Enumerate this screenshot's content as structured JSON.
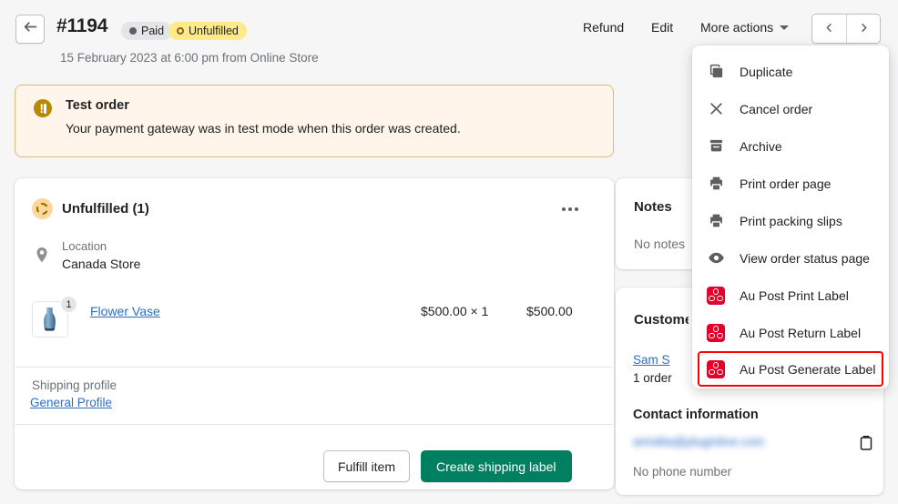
{
  "header": {
    "back_icon": "arrow-left-icon",
    "order_number": "#1194",
    "badges": [
      {
        "label": "Paid",
        "style": "grey",
        "icon": "filled-dot-icon"
      },
      {
        "label": "Unfulfilled",
        "style": "yellow",
        "icon": "hollow-ring-icon"
      }
    ],
    "order_meta": "15 February 2023 at 6:00 pm from Online Store",
    "actions": {
      "refund": "Refund",
      "edit": "Edit",
      "more_actions": "More actions"
    },
    "pager": {
      "prev_icon": "chevron-left-icon",
      "next_icon": "chevron-right-icon"
    }
  },
  "banner": {
    "icon": "alert-circle-icon",
    "title": "Test order",
    "body": "Your payment gateway was in test mode when this order was created.",
    "accent_color": "#b98900",
    "background_color": "#fff5ea"
  },
  "fulfillment": {
    "status_icon": "dashed-circle-icon",
    "title": "Unfulfilled (1)",
    "more_icon": "ellipsis-horizontal-icon",
    "location_icon": "map-pin-icon",
    "location_label": "Location",
    "location_value": "Canada Store",
    "line_item": {
      "image": "flower-vase-thumbnail",
      "quantity_badge": "1",
      "name": "Flower Vase",
      "unit_price": "$500.00 × 1",
      "total_price": "$500.00"
    },
    "shipping_profile_label": "Shipping profile",
    "shipping_profile_value": "General Profile",
    "buttons": {
      "secondary": "Fulfill item",
      "primary": "Create shipping label",
      "primary_color": "#008060"
    }
  },
  "notes": {
    "title": "Notes",
    "empty_text": "No notes f"
  },
  "customer": {
    "title": "Customer",
    "name": "Sam S",
    "orders": "1 order",
    "contact_title": "Contact information",
    "email": "arindita@plugintive.com",
    "email_redacted": true,
    "copy_icon": "clipboard-icon",
    "phone": "No phone number"
  },
  "more_actions_menu": {
    "highlight_color": "#ff0000",
    "items": [
      {
        "label": "Duplicate",
        "icon": "duplicate-icon",
        "highlighted": false
      },
      {
        "label": "Cancel order",
        "icon": "close-x-icon",
        "highlighted": false
      },
      {
        "label": "Archive",
        "icon": "archive-icon",
        "highlighted": false
      },
      {
        "label": "Print order page",
        "icon": "printer-icon",
        "highlighted": false
      },
      {
        "label": "Print packing slips",
        "icon": "printer-icon",
        "highlighted": false
      },
      {
        "label": "View order status page",
        "icon": "eye-icon",
        "highlighted": false
      },
      {
        "label": "Au Post Print Label",
        "icon": "au-post-icon",
        "highlighted": false
      },
      {
        "label": "Au Post Return Label",
        "icon": "au-post-icon",
        "highlighted": false
      },
      {
        "label": "Au Post Generate Label",
        "icon": "au-post-icon",
        "highlighted": true
      }
    ]
  }
}
